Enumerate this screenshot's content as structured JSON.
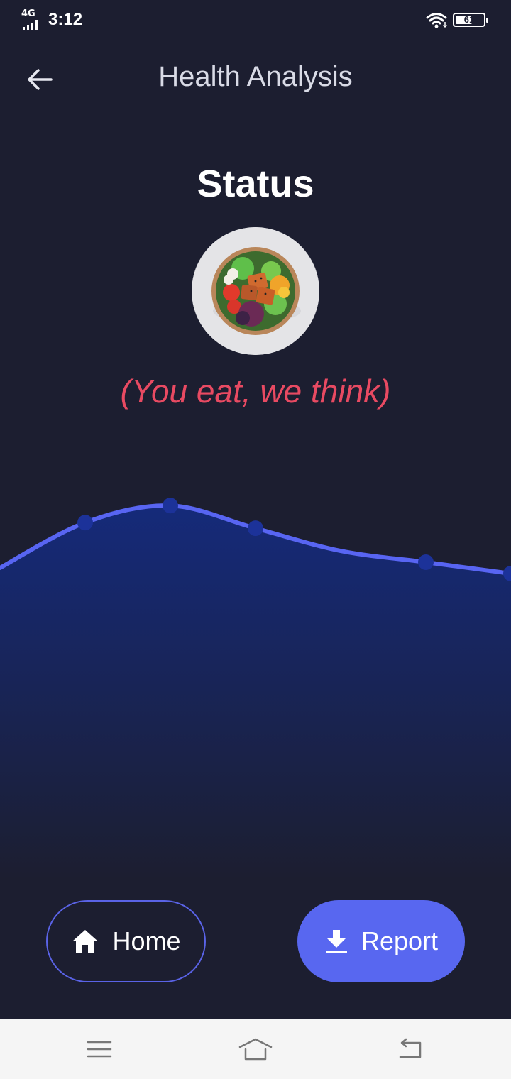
{
  "status_bar": {
    "network": "4G",
    "time": "3:12",
    "battery": "61",
    "battery_level": 0.61
  },
  "app_bar": {
    "title": "Health Analysis",
    "back_icon": "arrow-left-icon"
  },
  "main": {
    "heading": "Status",
    "image_icon": "salad-bowl-image",
    "tagline": "(You eat, we think)"
  },
  "chart_data": {
    "type": "area",
    "x": [
      0,
      1,
      2,
      3,
      4,
      5,
      6
    ],
    "y": [
      50,
      66,
      72,
      64,
      56,
      52,
      48
    ],
    "marked_points": [
      1,
      2,
      3,
      5,
      6
    ],
    "line_color": "#5865f2",
    "fill_top_color": "#152a7a",
    "fill_bottom_color": "#1c1e30",
    "grid": false
  },
  "actions": {
    "home_label": "Home",
    "home_icon": "home-icon",
    "report_label": "Report",
    "report_icon": "download-icon"
  },
  "colors": {
    "background": "#1c1e30",
    "accent": "#5867f0",
    "tagline": "#e84a62"
  },
  "nav_bar": {
    "menu_icon": "menu-icon",
    "home_icon": "nav-home-icon",
    "back_icon": "nav-back-icon"
  }
}
